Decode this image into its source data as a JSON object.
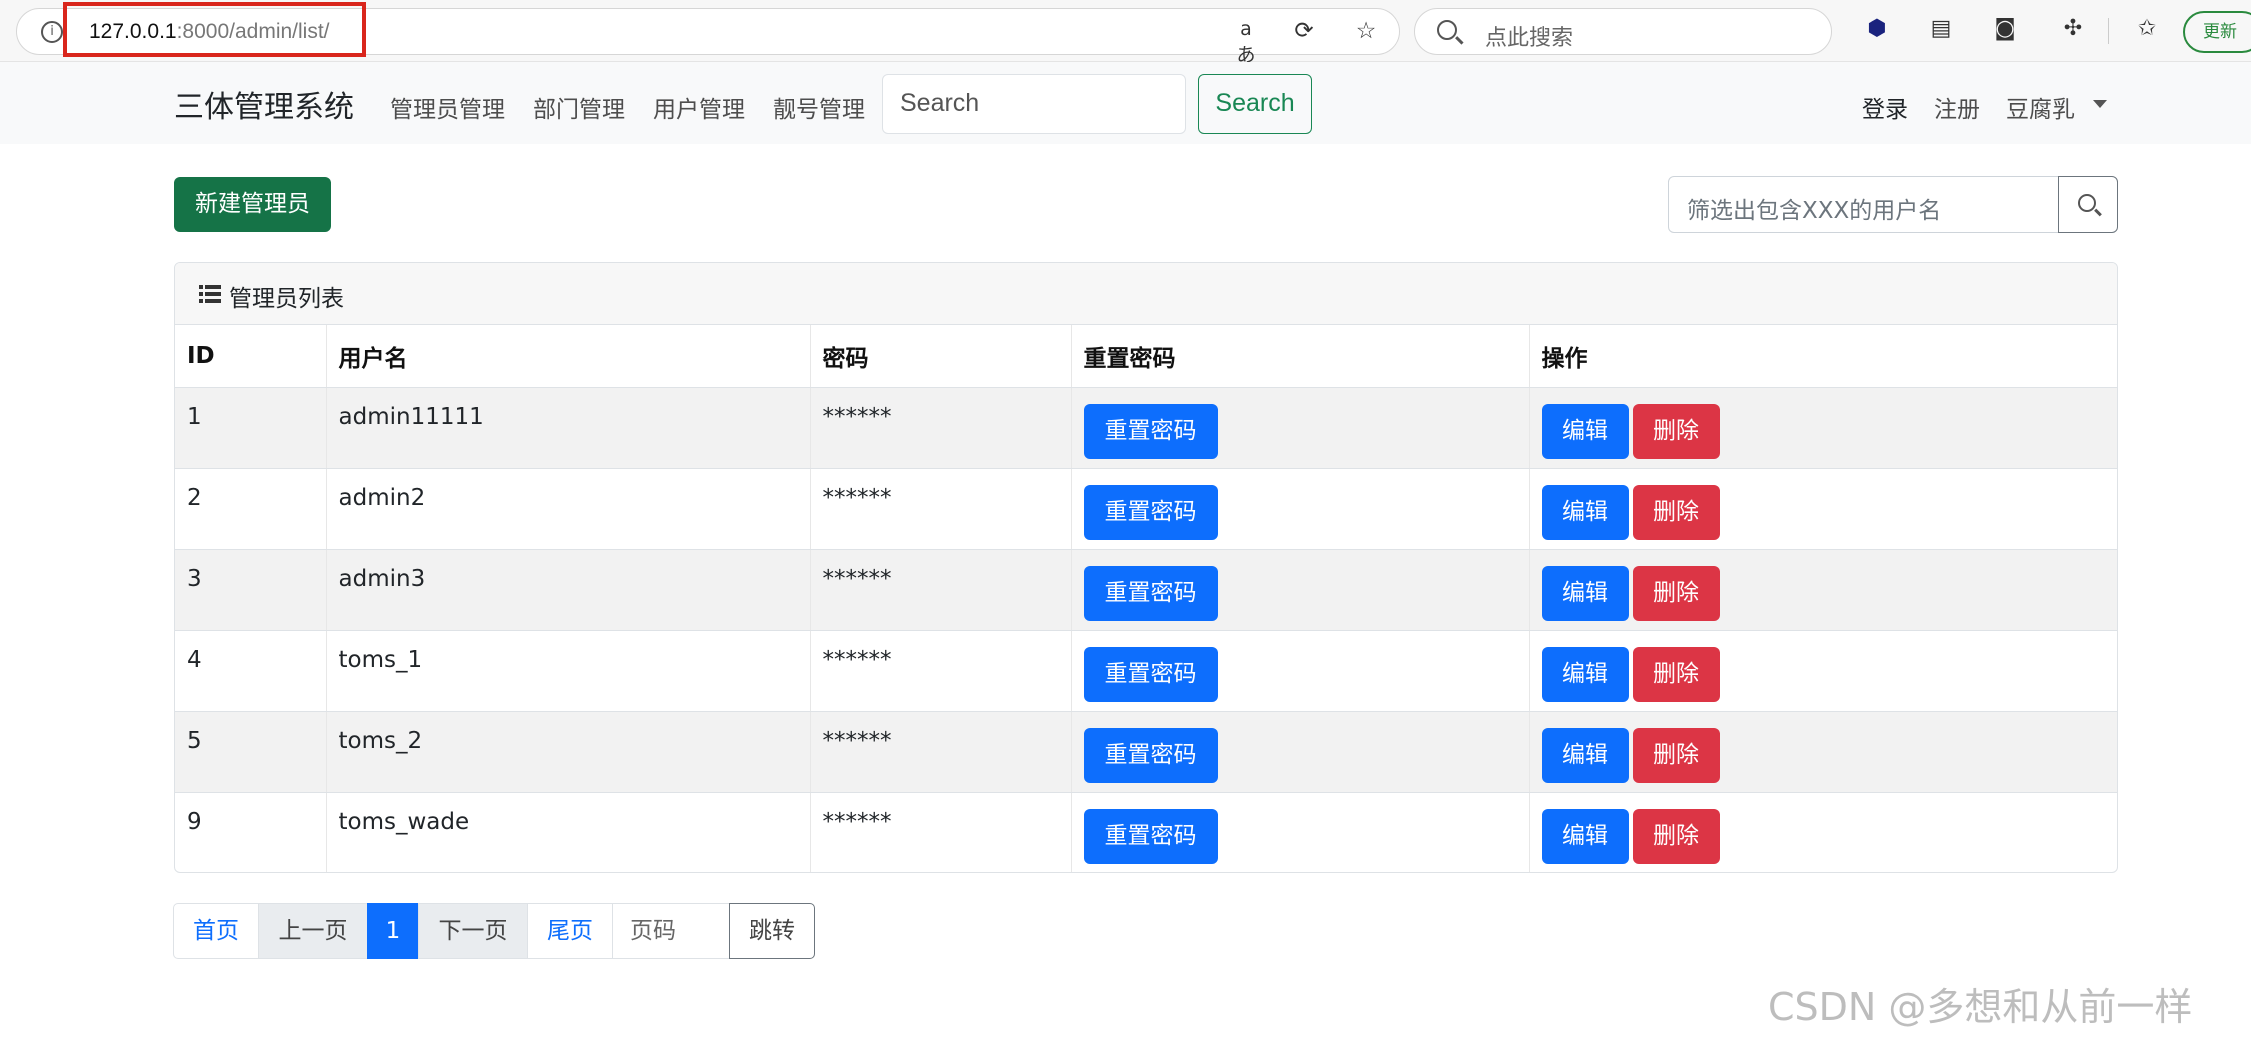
{
  "browser": {
    "url_host": "127.0.0.1",
    "url_rest": ":8000/admin/list/",
    "search_placeholder": "点此搜索",
    "update_label": "更新"
  },
  "navbar": {
    "brand": "三体管理系统",
    "links": [
      "管理员管理",
      "部门管理",
      "用户管理",
      "靓号管理"
    ],
    "search_placeholder": "Search",
    "search_button": "Search",
    "login": "登录",
    "register": "注册",
    "user": "豆腐乳"
  },
  "toolbar": {
    "new_button": "新建管理员",
    "filter_placeholder": "筛选出包含XXX的用户名"
  },
  "card": {
    "title": "管理员列表"
  },
  "table": {
    "columns": [
      "ID",
      "用户名",
      "密码",
      "重置密码",
      "操作"
    ],
    "rows": [
      {
        "id": "1",
        "username": "admin11111",
        "password": "******"
      },
      {
        "id": "2",
        "username": "admin2",
        "password": "******"
      },
      {
        "id": "3",
        "username": "admin3",
        "password": "******"
      },
      {
        "id": "4",
        "username": "toms_1",
        "password": "******"
      },
      {
        "id": "5",
        "username": "toms_2",
        "password": "******"
      },
      {
        "id": "9",
        "username": "toms_wade",
        "password": "******"
      }
    ],
    "reset_label": "重置密码",
    "edit_label": "编辑",
    "delete_label": "删除"
  },
  "pagination": {
    "first": "首页",
    "prev": "上一页",
    "current": "1",
    "next": "下一页",
    "last": "尾页",
    "page_input_placeholder": "页码",
    "go": "跳转"
  },
  "watermark": "CSDN @多想和从前一样",
  "colors": {
    "primary": "#0d6efd",
    "success": "#157347",
    "danger": "#dc3545",
    "highlight": "#d9261c"
  }
}
